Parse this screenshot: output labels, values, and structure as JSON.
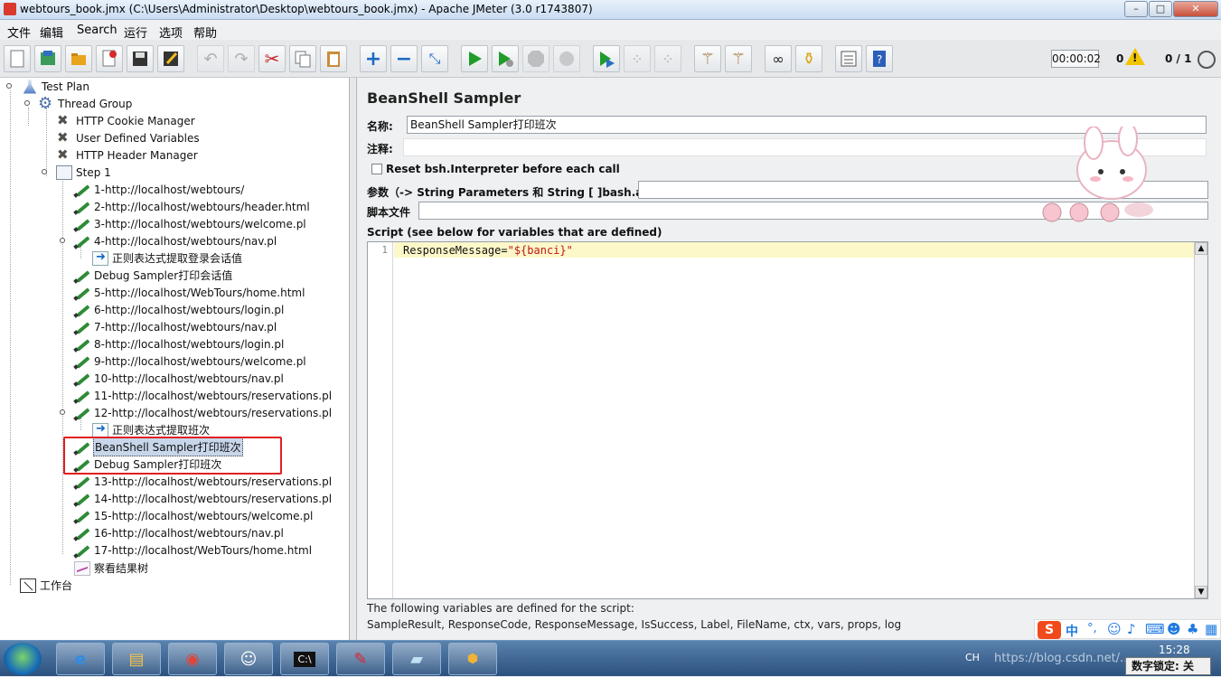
{
  "window": {
    "title": "webtours_book.jmx (C:\\Users\\Administrator\\Desktop\\webtours_book.jmx) - Apache JMeter (3.0 r1743807)",
    "minimize": "–",
    "maximize": "□",
    "close": "✕"
  },
  "menu": [
    "文件",
    "编辑",
    "Search",
    "运行",
    "选项",
    "帮助"
  ],
  "toolbar": {
    "buttons": [
      "new",
      "templates",
      "open",
      "close",
      "save",
      "save-as",
      "undo",
      "redo",
      "cut",
      "copy",
      "paste",
      "expand",
      "collapse",
      "toggle",
      "start",
      "start-no-pause",
      "stop",
      "shutdown",
      "remote-start",
      "remote-stop",
      "remote-shutdown",
      "clear",
      "clear-all",
      "search",
      "reset-search",
      "function-helper",
      "help"
    ],
    "elapsed_time": "00:00:02",
    "error_count": "0",
    "warning_symbol": "!",
    "thread_ratio": "0 / 1"
  },
  "tree": [
    {
      "label": "Test Plan",
      "icon": "testplan-icon"
    },
    {
      "label": "Thread Group",
      "icon": "gear-icon"
    },
    {
      "label": "HTTP Cookie Manager",
      "icon": "wrench-icon"
    },
    {
      "label": "User Defined Variables",
      "icon": "wrench-icon"
    },
    {
      "label": "HTTP Header Manager",
      "icon": "wrench-icon"
    },
    {
      "label": "Step 1",
      "icon": "transaction-icon"
    },
    {
      "label": "1-http://localhost/webtours/",
      "icon": "sampler-icon"
    },
    {
      "label": "2-http://localhost/webtours/header.html",
      "icon": "sampler-icon"
    },
    {
      "label": "3-http://localhost/webtours/welcome.pl",
      "icon": "sampler-icon"
    },
    {
      "label": "4-http://localhost/webtours/nav.pl",
      "icon": "sampler-icon"
    },
    {
      "label": "正则表达式提取登录会话值",
      "icon": "extractor-icon"
    },
    {
      "label": "Debug Sampler打印会话值",
      "icon": "sampler-icon"
    },
    {
      "label": "5-http://localhost/WebTours/home.html",
      "icon": "sampler-icon"
    },
    {
      "label": "6-http://localhost/webtours/login.pl",
      "icon": "sampler-icon"
    },
    {
      "label": "7-http://localhost/webtours/nav.pl",
      "icon": "sampler-icon"
    },
    {
      "label": "8-http://localhost/webtours/login.pl",
      "icon": "sampler-icon"
    },
    {
      "label": "9-http://localhost/webtours/welcome.pl",
      "icon": "sampler-icon"
    },
    {
      "label": "10-http://localhost/webtours/nav.pl",
      "icon": "sampler-icon"
    },
    {
      "label": "11-http://localhost/webtours/reservations.pl",
      "icon": "sampler-icon"
    },
    {
      "label": "12-http://localhost/webtours/reservations.pl",
      "icon": "sampler-icon"
    },
    {
      "label": "正则表达式提取班次",
      "icon": "extractor-icon"
    },
    {
      "label": "BeanShell Sampler打印班次",
      "icon": "sampler-icon",
      "selected": true
    },
    {
      "label": "Debug Sampler打印班次",
      "icon": "sampler-icon"
    },
    {
      "label": "13-http://localhost/webtours/reservations.pl",
      "icon": "sampler-icon"
    },
    {
      "label": "14-http://localhost/webtours/reservations.pl",
      "icon": "sampler-icon"
    },
    {
      "label": "15-http://localhost/webtours/welcome.pl",
      "icon": "sampler-icon"
    },
    {
      "label": "16-http://localhost/webtours/nav.pl",
      "icon": "sampler-icon"
    },
    {
      "label": "17-http://localhost/WebTours/home.html",
      "icon": "sampler-icon"
    },
    {
      "label": "察看结果树",
      "icon": "listener-icon"
    },
    {
      "label": "工作台",
      "icon": "workbench-icon"
    }
  ],
  "panel": {
    "title": "BeanShell Sampler",
    "name_label": "名称:",
    "name_value": "BeanShell Sampler打印班次",
    "comment_label": "注释:",
    "comment_value": "",
    "reset_label": "Reset bsh.Interpreter before each call",
    "reset_checked": false,
    "params_label": "参数（-> String Parameters 和 String [ ]bash.args）",
    "params_value": "",
    "script_file_label": "脚本文件",
    "script_file_value": "",
    "script_label": "Script (see below for variables that are defined)",
    "script_line_number": "1",
    "script_code_prefix": "ResponseMessage=",
    "script_code_string": "\"${banci}\"",
    "vars_note_1": "The following variables are defined for the script:",
    "vars_note_2": "SampleResult, ResponseCode, ResponseMessage, IsSuccess, Label, FileName, ctx, vars, props, log"
  },
  "taskbar": {
    "apps": [
      "internet-explorer-icon",
      "file-explorer-icon",
      "chrome-icon",
      "jmeter-icon",
      "cmd-icon",
      "editor-icon",
      "notepad-icon",
      "javaee-ide-icon"
    ],
    "lang": "CH",
    "watermark": "https://blog.csdn.net/...",
    "time": "15:28",
    "ime_brand": "S",
    "ime_mode": "中",
    "numlock": "数字锁定: 关"
  },
  "colors": {
    "selection": "#c8d6ea",
    "highlight_box": "#e02020",
    "code_line": "#fcf8c9",
    "code_string": "#c21616"
  }
}
